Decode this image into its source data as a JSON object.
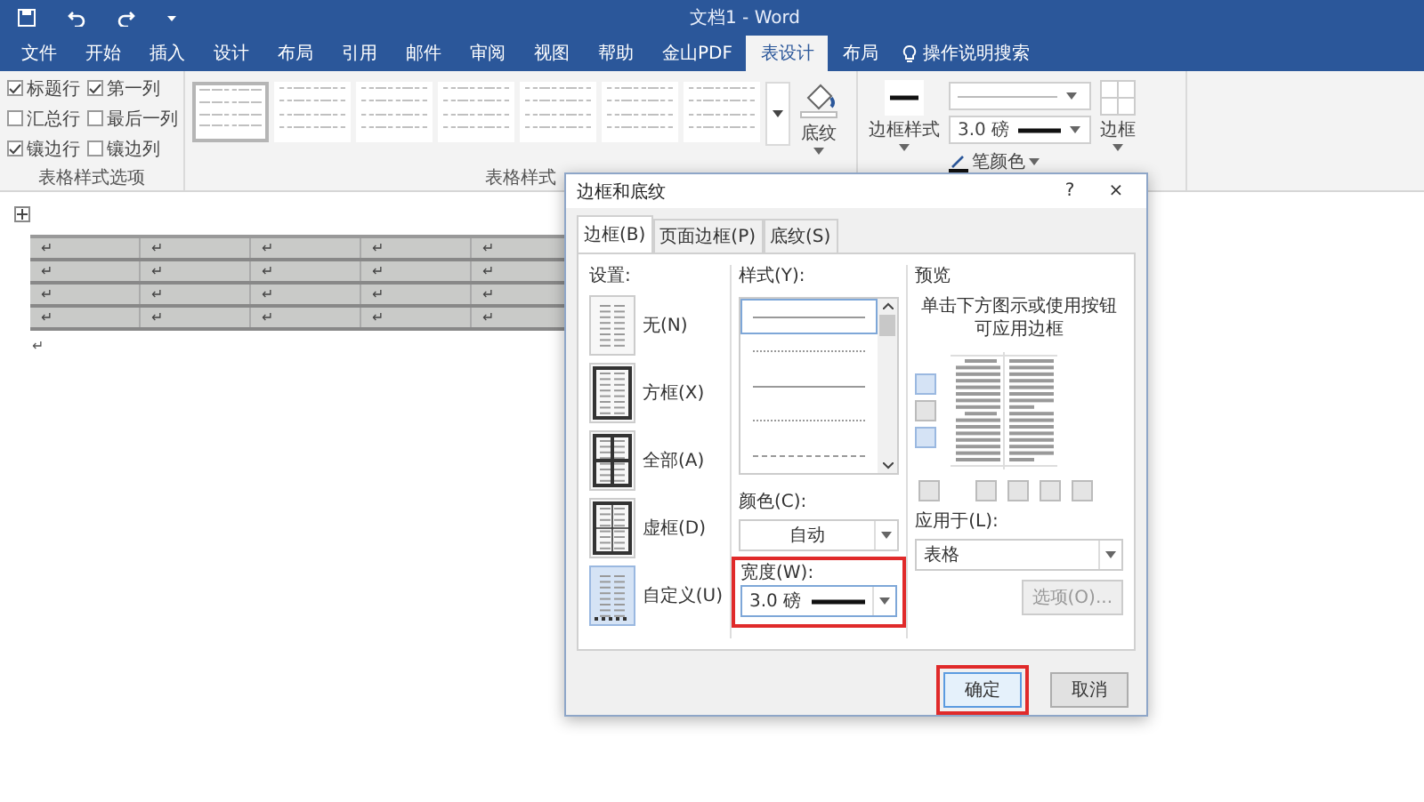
{
  "title_bar": {
    "title": "文档1 - Word"
  },
  "ribbon_tabs": [
    {
      "label": "文件",
      "selected": false
    },
    {
      "label": "开始",
      "selected": false
    },
    {
      "label": "插入",
      "selected": false
    },
    {
      "label": "设计",
      "selected": false
    },
    {
      "label": "布局",
      "selected": false
    },
    {
      "label": "引用",
      "selected": false
    },
    {
      "label": "邮件",
      "selected": false
    },
    {
      "label": "审阅",
      "selected": false
    },
    {
      "label": "视图",
      "selected": false
    },
    {
      "label": "帮助",
      "selected": false
    },
    {
      "label": "金山PDF",
      "selected": false
    },
    {
      "label": "表设计",
      "selected": true
    },
    {
      "label": "布局",
      "selected": false
    }
  ],
  "tell_me": "操作说明搜索",
  "ribbon": {
    "style_options": {
      "checkboxes": [
        {
          "label": "标题行",
          "checked": true
        },
        {
          "label": "第一列",
          "checked": true
        },
        {
          "label": "汇总行",
          "checked": false
        },
        {
          "label": "最后一列",
          "checked": false
        },
        {
          "label": "镶边行",
          "checked": true
        },
        {
          "label": "镶边列",
          "checked": false
        }
      ],
      "label": "表格样式选项"
    },
    "table_styles": {
      "thumbnails": [
        {
          "selected": true
        },
        {
          "selected": false
        },
        {
          "selected": false
        },
        {
          "selected": false
        },
        {
          "selected": false
        },
        {
          "selected": false
        },
        {
          "selected": false
        }
      ],
      "shading": "底纹",
      "label": "表格样式"
    },
    "borders": {
      "border_styles": "边框样式",
      "line_width": "3.0 磅",
      "pen_color": "笔颜色",
      "borders": "边框"
    }
  },
  "document": {
    "table_rows": [
      [
        "↵",
        "↵",
        "↵",
        "↵",
        "↵"
      ],
      [
        "↵",
        "↵",
        "↵",
        "↵",
        "↵"
      ],
      [
        "↵",
        "↵",
        "↵",
        "↵",
        "↵"
      ],
      [
        "↵",
        "↵",
        "↵",
        "↵",
        "↵"
      ]
    ],
    "trailing_mark": "↵"
  },
  "dialog": {
    "title": "边框和底纹",
    "help": "?",
    "close": "×",
    "tabs": [
      {
        "label": "边框(B)",
        "selected": true
      },
      {
        "label": "页面边框(P)",
        "selected": false
      },
      {
        "label": "底纹(S)",
        "selected": false
      }
    ],
    "settings_label": "设置:",
    "settings": [
      {
        "kind": "none",
        "label": "无(N)",
        "selected": false
      },
      {
        "kind": "box",
        "label": "方框(X)",
        "selected": false
      },
      {
        "kind": "all",
        "label": "全部(A)",
        "selected": false
      },
      {
        "kind": "grid",
        "label": "虚框(D)",
        "selected": false
      },
      {
        "kind": "custom",
        "label": "自定义(U)",
        "selected": true
      }
    ],
    "style_label": "样式(Y):",
    "styles": [
      {
        "kind": "solid",
        "selected": true
      },
      {
        "kind": "dotted",
        "selected": false
      },
      {
        "kind": "solid",
        "selected": false
      },
      {
        "kind": "dotted",
        "selected": false
      },
      {
        "kind": "dashed",
        "selected": false
      }
    ],
    "color_label": "颜色(C):",
    "color_value": "自动",
    "width": {
      "label": "宽度(W):",
      "value": "3.0 磅",
      "highlighted": true
    },
    "preview_label": "预览",
    "preview_hint": "单击下方图示或使用按钮可应用边框",
    "apply_label": "应用于(L):",
    "apply_value": "表格",
    "options": {
      "label": "选项(O)...",
      "disabled": true
    },
    "buttons": [
      {
        "label": "确定",
        "highlighted": true
      },
      {
        "label": "取消",
        "highlighted": false
      }
    ]
  }
}
